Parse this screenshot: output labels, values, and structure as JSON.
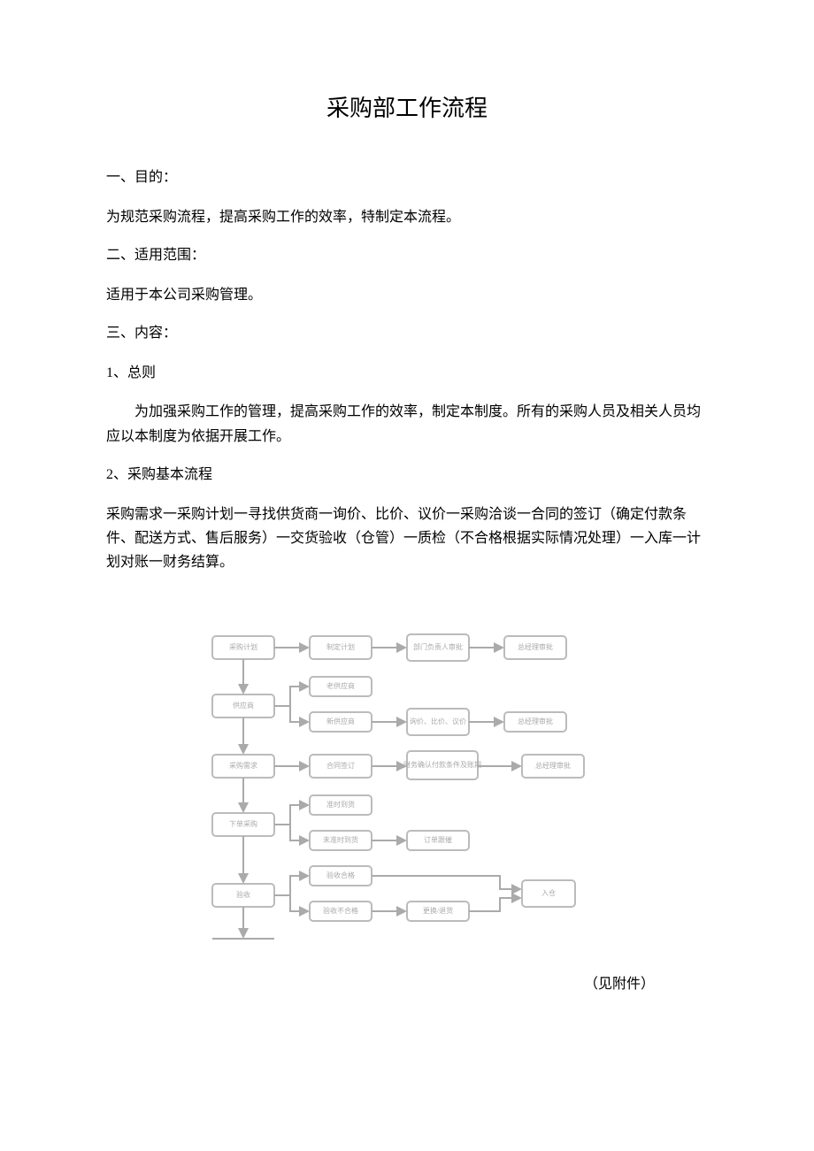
{
  "title": "采购部工作流程",
  "sections": {
    "s1_heading": "一、目的：",
    "s1_body": "为规范采购流程，提高采购工作的效率，特制定本流程。",
    "s2_heading": "二、适用范围：",
    "s2_body": "适用于本公司采购管理。",
    "s3_heading": "三、内容：",
    "s3_sub1_heading": "1、总则",
    "s3_sub1_body": "为加强采购工作的管理，提高采购工作的效率，制定本制度。所有的采购人员及相关人员均应以本制度为依据开展工作。",
    "s3_sub2_heading": "2、采购基本流程",
    "s3_sub2_body": "采购需求一采购计划一寻找供货商一询价、比价、议价一采购洽谈一合同的签订（确定付款条件、配送方式、售后服务）一交货验收（仓管）一质检（不合格根据实际情况处理）一入库一计划对账一财务结算。"
  },
  "flowchart": {
    "row1": {
      "a": "采购计划",
      "b": "制定计划",
      "c": "部门负责人审批",
      "d": "总经理审批"
    },
    "row2": {
      "a": "供应商",
      "b1": "老供应商",
      "b2": "新供应商",
      "c": "询价、比价、议价",
      "d": "总经理审批"
    },
    "row3": {
      "a": "采购需求",
      "b": "合同签订",
      "c": "财务确认付款条件及账期",
      "d": "总经理审批"
    },
    "row4": {
      "a": "下单采购",
      "b1": "准时到货",
      "b2": "未准时到货",
      "c": "订单跟催"
    },
    "row5": {
      "a": "验收",
      "b1": "验收合格",
      "b2": "验收不合格",
      "c": "更换/退货",
      "d": "入仓"
    }
  },
  "attachment_note": "（见附件）"
}
